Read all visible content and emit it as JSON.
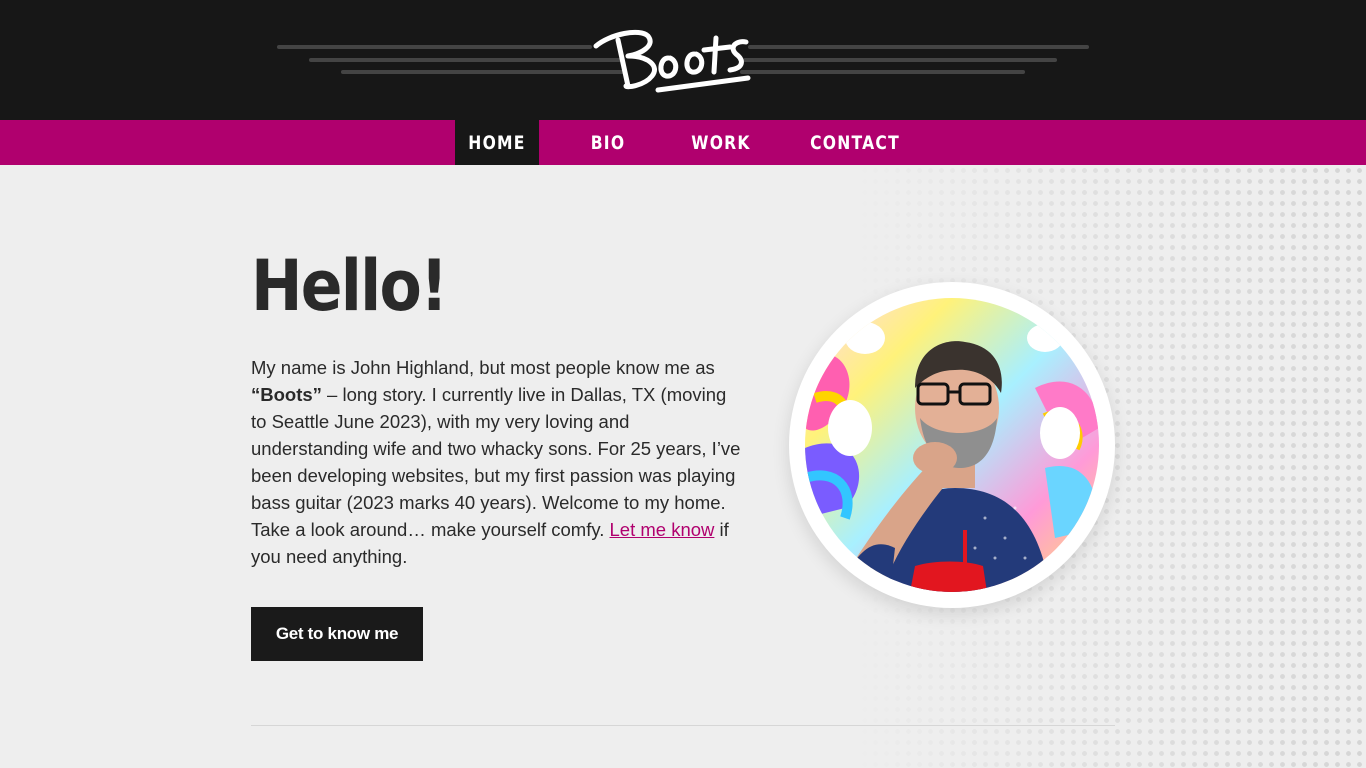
{
  "header": {
    "logo_text": "Boots"
  },
  "nav": {
    "items": [
      {
        "label": "HOME",
        "active": true
      },
      {
        "label": "BIO",
        "active": false
      },
      {
        "label": "WORK",
        "active": false
      },
      {
        "label": "CONTACT",
        "active": false
      }
    ]
  },
  "hero": {
    "heading": "Hello!",
    "intro_part1": "My name is John Highland, but most people know me as ",
    "nickname": "“Boots”",
    "intro_part2": " – long story. I currently live in Dallas, TX (moving to Seattle June 2023), with my very loving and understanding wife and two whacky sons. For 25 years, I’ve been developing websites, but my first passion was playing bass guitar (2023 marks 40 years). Welcome to my home. Take a look around… make yourself comfy. ",
    "link_text": "Let me know",
    "intro_part3": " if you need anything.",
    "cta_label": "Get to know me"
  },
  "colors": {
    "header_bg": "#171717",
    "nav_bg": "#b0006e",
    "accent": "#b0006e",
    "page_bg": "#eeeeee"
  }
}
